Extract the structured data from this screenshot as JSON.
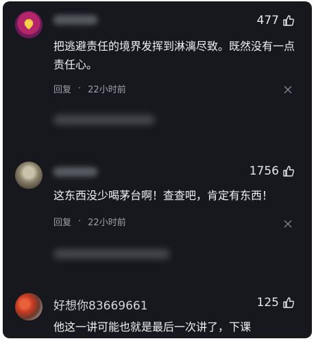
{
  "comments": [
    {
      "username": "",
      "likes": "477",
      "text": "把逃避责任的境界发挥到淋漓尽致。既然没有一点责任心。",
      "reply_label": "回复",
      "separator": "·",
      "time": "22小时前"
    },
    {
      "username": "",
      "likes": "1756",
      "text": "这东西没少喝茅台啊！查查吧，肯定有东西！",
      "reply_label": "回复",
      "separator": "·",
      "time": "22小时前"
    },
    {
      "username": "好想你83669661",
      "likes": "125",
      "text": "他这一讲可能也就是最后一次讲了，下课"
    }
  ],
  "colors": {
    "background": "#16181d",
    "text": "#f0f1f3",
    "meta": "#9da0a6"
  },
  "icons": [
    "thumb-up-icon",
    "close-icon"
  ]
}
